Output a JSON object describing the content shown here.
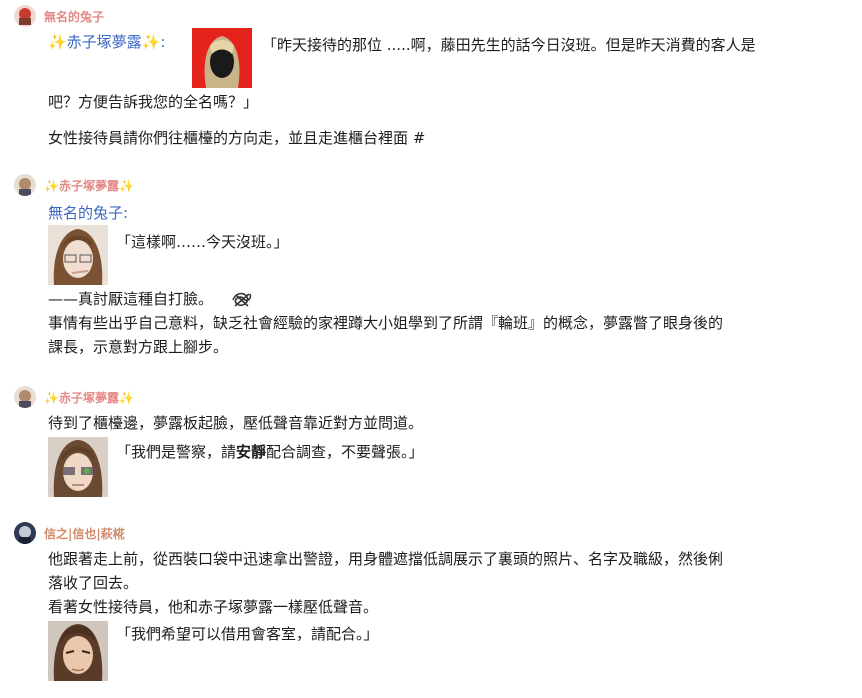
{
  "posts": [
    {
      "author": "無名的兔子",
      "mention": "✨赤子塚夢露✨:",
      "quote_first": "「昨天接待的那位 .....啊，藤田先生的話今日沒班。但是昨天消費的客人是",
      "quote_second": "吧？方便告訴我您的全名嗎？」",
      "narration": "女性接待員請你們往櫃檯的方向走，並且走進櫃台裡面 #"
    },
    {
      "author": "✨赤子塚夢露✨",
      "mention": "無名的兔子:",
      "quote": "「這樣啊……今天沒班。」",
      "line1": "——真討厭這種自打臉。",
      "line2": "事情有些出乎自己意料，缺乏社會經驗的家裡蹲大小姐學到了所謂『輪班』的概念，夢露瞥了眼身後的",
      "line3": "課長，示意對方跟上腳步。"
    },
    {
      "author": "✨赤子塚夢露✨",
      "line1": "待到了櫃檯邊，夢露板起臉，壓低聲音靠近對方並問道。",
      "quote_start": "「我們是警察，請",
      "quote_bold": "安靜",
      "quote_end": "配合調查，不要聲張。」"
    },
    {
      "author": "信之|信也|萩椛",
      "line1": "他跟著走上前，從西裝口袋中迅速拿出警證，用身體遮擋低調展示了裏頭的照片、名字及職級，然後俐",
      "line2": "落收了回去。",
      "line3": "看著女性接待員，他和赤子塚夢露一樣壓低聲音。",
      "quote": "「我們希望可以借用會客室，請配合。」"
    }
  ],
  "colors": {
    "author_name": "#e38a87",
    "mention": "#3a67c4",
    "text": "#1d1d1d"
  }
}
